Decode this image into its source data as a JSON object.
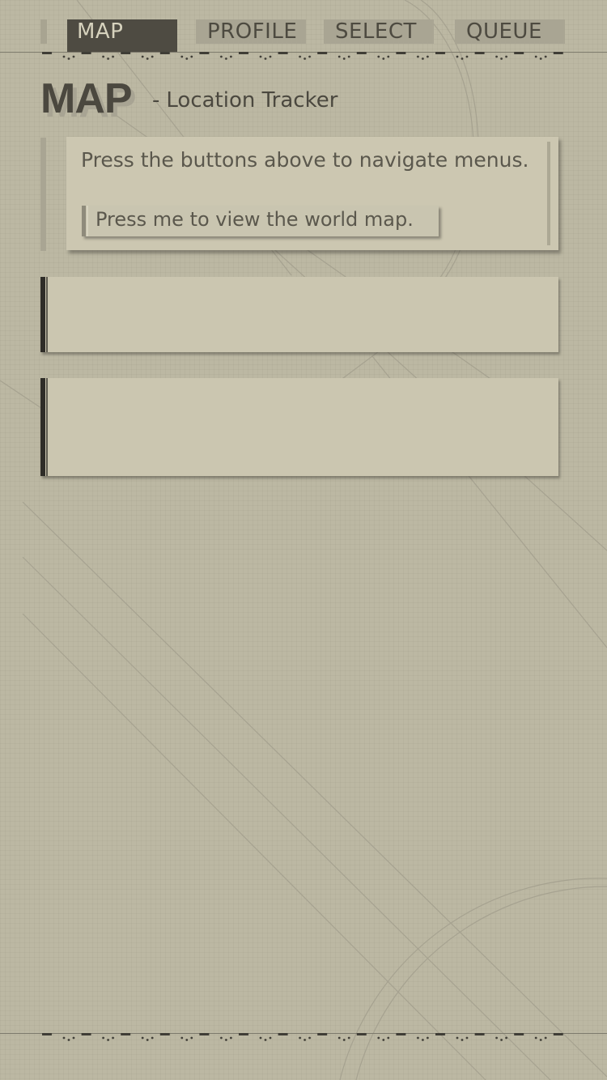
{
  "nav": {
    "tabs": [
      {
        "label": "MAP",
        "active": true
      },
      {
        "label": "PROFILE",
        "active": false
      },
      {
        "label": "SELECT",
        "active": false
      },
      {
        "label": "QUEUE",
        "active": false
      }
    ]
  },
  "header": {
    "title": "MAP",
    "subtitle_dash": "-",
    "subtitle": "Location Tracker"
  },
  "info_card": {
    "text": "Press the buttons above to navigate menus.",
    "button_label": "Press me to view the world map."
  },
  "colors": {
    "background": "#bcb8a3",
    "accent_dark": "#4e4b42",
    "panel": "#cbc6b0",
    "tab_inactive": "#a9a593"
  }
}
